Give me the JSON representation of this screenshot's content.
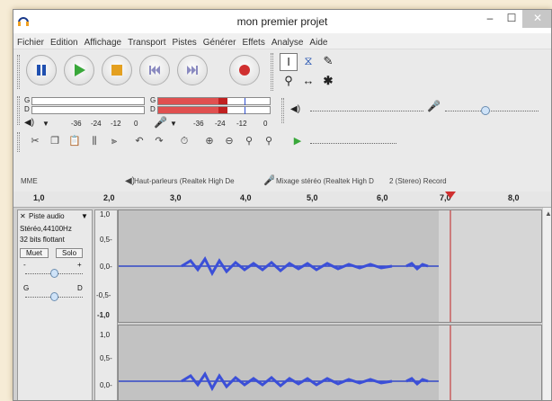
{
  "window": {
    "title": "mon premier projet",
    "minimize": "–",
    "maximize": "☐",
    "close": "✕"
  },
  "menu": [
    "Fichier",
    "Edition",
    "Affichage",
    "Transport",
    "Pistes",
    "Générer",
    "Effets",
    "Analyse",
    "Aide"
  ],
  "meters": {
    "play_channels": [
      "G",
      "D"
    ],
    "rec_channels": [
      "G",
      "D"
    ],
    "scale": [
      "-36",
      "-24",
      "-12",
      "0"
    ],
    "rec_scale": [
      "-36",
      "-24",
      "-12",
      "0"
    ]
  },
  "devices": {
    "host": "MME",
    "output": "Haut-parleurs (Realtek High De",
    "input": "Mixage stéréo (Realtek High D",
    "channels": "2 (Stereo) Record"
  },
  "ruler": [
    "1,0",
    "2,0",
    "3,0",
    "4,0",
    "5,0",
    "6,0",
    "7,0",
    "8,0"
  ],
  "track": {
    "name": "Piste audio",
    "format": "Stéréo,44100Hz",
    "bits": "32 bits flottant",
    "mute": "Muet",
    "solo": "Solo",
    "gain_minus": "-",
    "gain_plus": "+",
    "pan_left": "G",
    "pan_right": "D"
  },
  "vscale_top": [
    "1,0",
    "0,5-",
    "0,0-",
    "-0,5-",
    "-1,0"
  ],
  "vscale_bottom": [
    "1,0",
    "0,5-",
    "0,0-"
  ],
  "icons": {
    "app": "headphones-icon",
    "pause": "pause-icon",
    "play": "play-icon",
    "stop": "stop-icon",
    "skip_start": "skip-start-icon",
    "skip_end": "skip-end-icon",
    "record": "record-icon"
  }
}
